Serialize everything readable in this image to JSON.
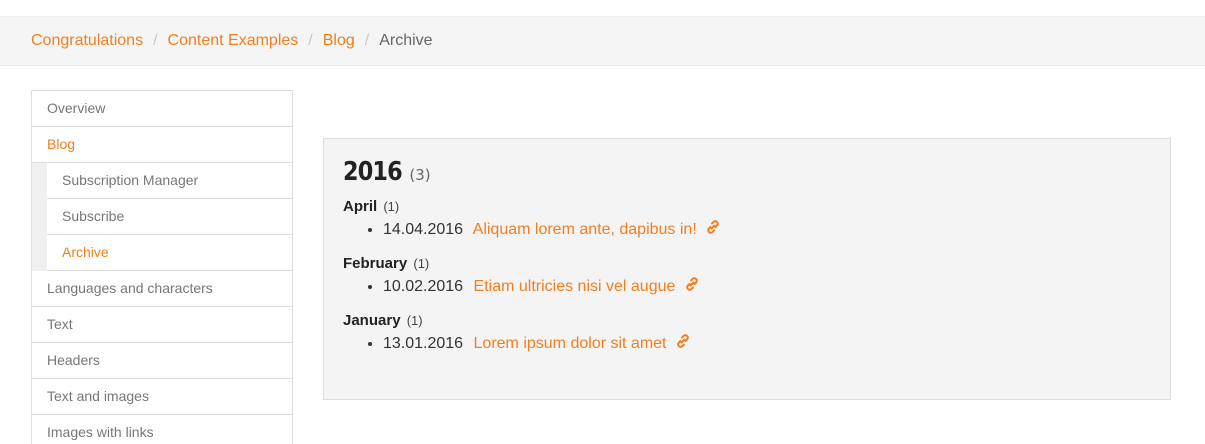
{
  "breadcrumb": {
    "items": [
      {
        "label": "Congratulations"
      },
      {
        "label": "Content Examples"
      },
      {
        "label": "Blog"
      }
    ],
    "separator": "/",
    "current": "Archive"
  },
  "sidebar": {
    "items": [
      {
        "label": "Overview"
      },
      {
        "label": "Blog"
      },
      {
        "label": "Languages and characters"
      },
      {
        "label": "Text"
      },
      {
        "label": "Headers"
      },
      {
        "label": "Text and images"
      },
      {
        "label": "Images with links"
      }
    ],
    "sub_items": [
      {
        "label": "Subscription Manager"
      },
      {
        "label": "Subscribe"
      },
      {
        "label": "Archive"
      }
    ]
  },
  "archive": {
    "year": "2016",
    "year_count": "(3)",
    "months": [
      {
        "name": "April",
        "count": "(1)",
        "posts": [
          {
            "date": "14.04.2016",
            "title": "Aliquam lorem ante, dapibus in!"
          }
        ]
      },
      {
        "name": "February",
        "count": "(1)",
        "posts": [
          {
            "date": "10.02.2016",
            "title": "Etiam ultricies nisi vel augue"
          }
        ]
      },
      {
        "name": "January",
        "count": "(1)",
        "posts": [
          {
            "date": "13.01.2016",
            "title": "Lorem ipsum dolor sit amet"
          }
        ]
      }
    ]
  },
  "colors": {
    "accent": "#f17f1f",
    "panel_bg": "#f4f4f4"
  },
  "icons": {
    "permalink": "link-icon"
  }
}
